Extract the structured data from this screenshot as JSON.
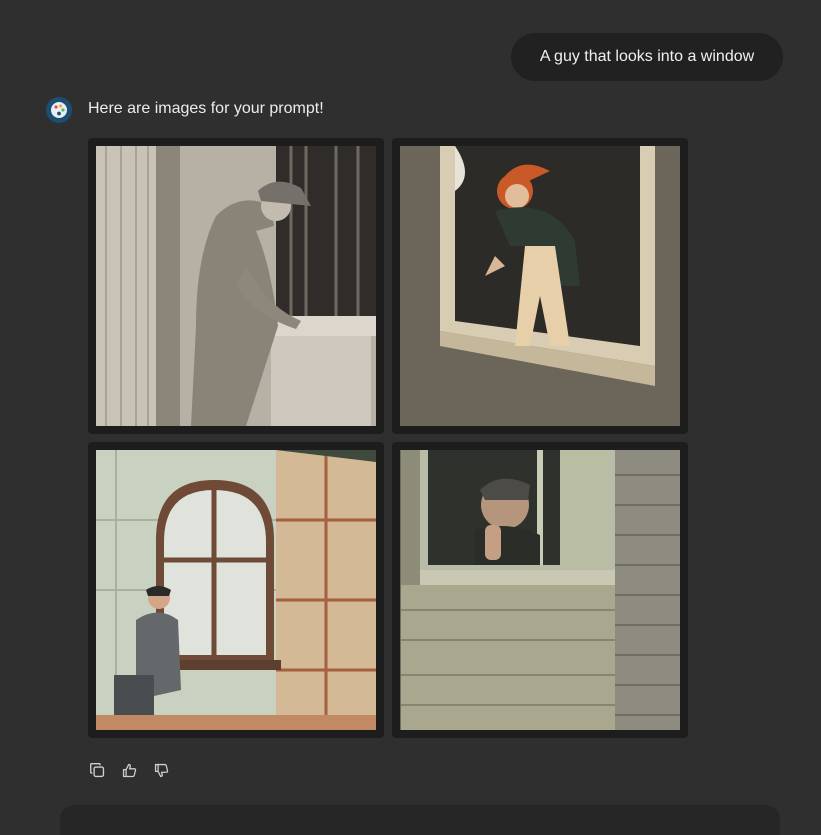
{
  "conversation": {
    "user_message": "A guy that looks into a window",
    "assistant_message": "Here are images for your prompt!"
  },
  "images": [
    {
      "icon": "generated-image-1"
    },
    {
      "icon": "generated-image-2"
    },
    {
      "icon": "generated-image-3"
    },
    {
      "icon": "generated-image-4"
    }
  ],
  "actions": {
    "copy_icon": "copy-icon",
    "thumbs_up_icon": "thumbs-up-icon",
    "thumbs_down_icon": "thumbs-down-icon"
  },
  "colors": {
    "background": "#2f2f2f",
    "bubble": "#212121",
    "avatar": "#1b4f72"
  }
}
